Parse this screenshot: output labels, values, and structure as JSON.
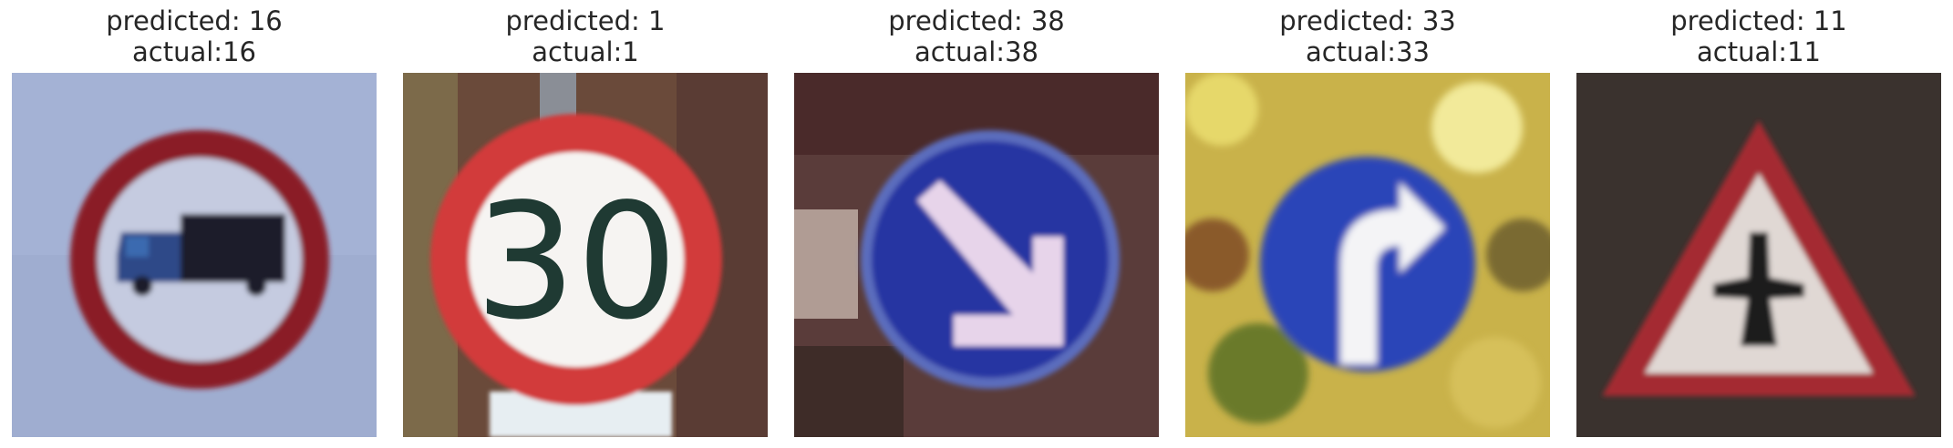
{
  "panels": [
    {
      "predicted": "predicted: 16",
      "actual": "actual:16",
      "sign": "no-trucks-sign"
    },
    {
      "predicted": "predicted: 1",
      "actual": "actual:1",
      "sign": "speed-limit-30-sign",
      "sign_text": "30"
    },
    {
      "predicted": "predicted: 38",
      "actual": "actual:38",
      "sign": "keep-right-sign"
    },
    {
      "predicted": "predicted: 33",
      "actual": "actual:33",
      "sign": "turn-right-ahead-sign"
    },
    {
      "predicted": "predicted: 11",
      "actual": "actual:11",
      "sign": "right-of-way-intersection-sign"
    }
  ],
  "colors": {
    "caption_text": "#262626",
    "sign_red": "#b21f24",
    "sign_blue": "#2a3fa8",
    "sign_white": "#f2f2f2"
  }
}
